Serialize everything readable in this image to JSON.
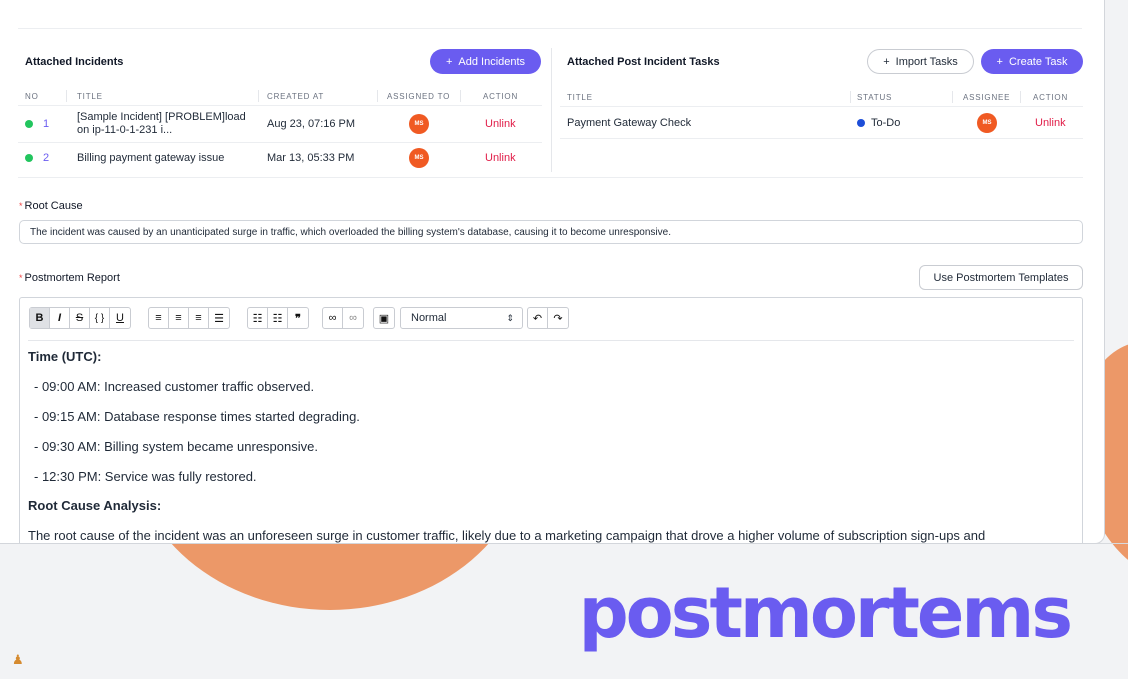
{
  "incidents_panel": {
    "title": "Attached Incidents",
    "add_button": "Add Incidents",
    "columns": [
      "NO",
      "TITLE",
      "CREATED AT",
      "ASSIGNED TO",
      "ACTION"
    ],
    "rows": [
      {
        "no": "1",
        "title_line1": "[Sample Incident] [PROBLEM]load",
        "title_line2": "on ip-11-0-1-231 i...",
        "created_at": "Aug 23, 07:16 PM",
        "assignee": "MS",
        "action": "Unlink"
      },
      {
        "no": "2",
        "title_line1": "Billing payment gateway issue",
        "title_line2": "",
        "created_at": "Mar 13, 05:33 PM",
        "assignee": "MS",
        "action": "Unlink"
      }
    ]
  },
  "tasks_panel": {
    "title": "Attached Post Incident Tasks",
    "import_button": "Import Tasks",
    "create_button": "Create Task",
    "columns": [
      "TITLE",
      "STATUS",
      "ASSIGNEE",
      "ACTION"
    ],
    "rows": [
      {
        "title": "Payment Gateway Check",
        "status": "To-Do",
        "assignee": "MS",
        "action": "Unlink"
      }
    ]
  },
  "root_cause": {
    "label": "Root Cause",
    "value": "The incident was caused by an unanticipated surge in traffic, which overloaded the billing system's database, causing it to become unresponsive."
  },
  "postmortem": {
    "label": "Postmortem Report",
    "templates_button": "Use Postmortem Templates",
    "format_select": "Normal",
    "content": {
      "time_heading": "Time (UTC):",
      "timeline": [
        "- 09:00 AM: Increased customer traffic observed.",
        "- 09:15 AM: Database response times started degrading.",
        "- 09:30 AM: Billing system became unresponsive.",
        "- 12:30 PM: Service was fully restored."
      ],
      "analysis_heading": "Root Cause Analysis:",
      "analysis_text": "The root cause of the incident was an unforeseen surge in customer traffic, likely due to a marketing campaign that drove a higher volume of subscription sign-ups and"
    }
  },
  "brand": "postmortems",
  "colors": {
    "accent": "#6a5cf0",
    "danger": "#e11d48",
    "status_green": "#22c55e",
    "status_blue": "#1d4ed8",
    "avatar": "#f05a23",
    "blob": "#ec9868"
  },
  "icons": {
    "plus": "plus-icon",
    "bold": "bold-icon",
    "italic": "italic-icon",
    "strike": "strikethrough-icon",
    "code": "code-icon",
    "underline": "underline-icon",
    "align_left": "align-left-icon",
    "align_center": "align-center-icon",
    "align_right": "align-right-icon",
    "justify": "align-justify-icon",
    "bullet_list": "bullet-list-icon",
    "ordered_list": "ordered-list-icon",
    "quote": "quote-icon",
    "link": "link-icon",
    "unlink": "unlink-icon",
    "image": "image-icon",
    "undo": "undo-icon",
    "redo": "redo-icon"
  }
}
